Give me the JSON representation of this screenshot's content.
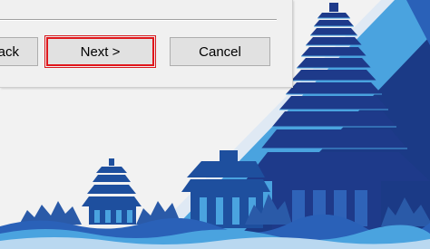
{
  "wizard": {
    "back_label": "< Back",
    "next_label": "Next >",
    "cancel_label": "Cancel"
  },
  "colors": {
    "highlight": "#e0161b",
    "temple_dark": "#1e3a8a",
    "temple_mid": "#2f63b8",
    "temple_light": "#4aa3df",
    "wave_light": "#b9d8f0"
  }
}
